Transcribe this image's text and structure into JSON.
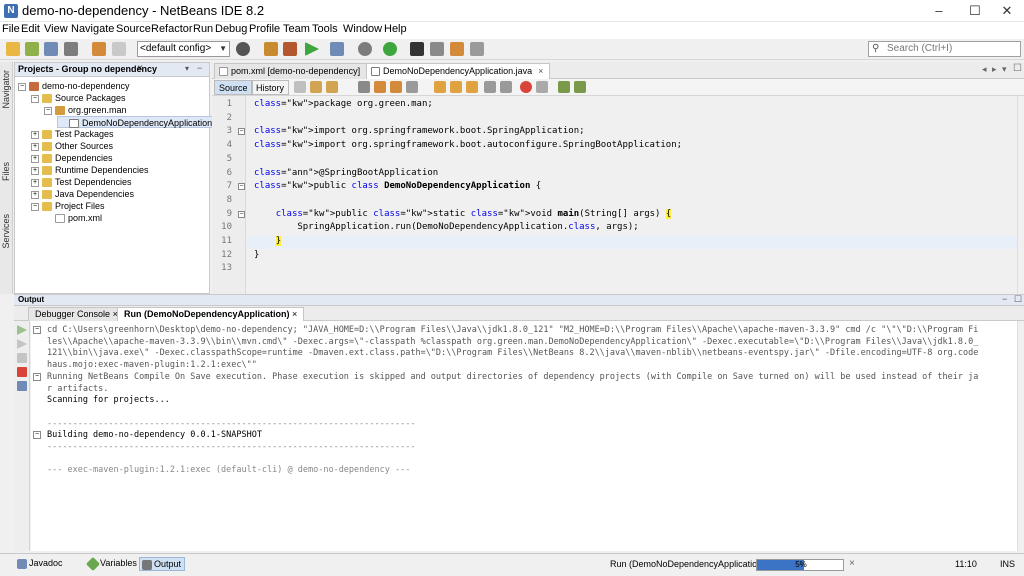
{
  "window": {
    "title": "demo-no-dependency - NetBeans IDE 8.2",
    "app_logo": "netbeans-logo",
    "controls": [
      "–",
      "☐",
      "✕"
    ]
  },
  "menu": [
    "File",
    "Edit",
    "View",
    "Navigate",
    "Source",
    "Refactor",
    "Run",
    "Debug",
    "Profile",
    "Team",
    "Tools",
    "Window",
    "Help"
  ],
  "toolbar": {
    "config": "<default config>",
    "search_placeholder": "Search (Ctrl+I)"
  },
  "side_labels": [
    "Navigator",
    "Files",
    "Services"
  ],
  "projects": {
    "title": "Projects - Group no dependency",
    "close": "×",
    "tree": [
      {
        "label": "demo-no-dependency",
        "level": 0,
        "toggle": "−",
        "icon": "project"
      },
      {
        "label": "Source Packages",
        "level": 1,
        "toggle": "−",
        "icon": "folder"
      },
      {
        "label": "org.green.man",
        "level": 2,
        "toggle": "−",
        "icon": "package"
      },
      {
        "label": "DemoNoDependencyApplication.java",
        "level": 3,
        "toggle": "",
        "icon": "java",
        "selected": true
      },
      {
        "label": "Test Packages",
        "level": 1,
        "toggle": "+",
        "icon": "folder"
      },
      {
        "label": "Other Sources",
        "level": 1,
        "toggle": "+",
        "icon": "folder"
      },
      {
        "label": "Dependencies",
        "level": 1,
        "toggle": "+",
        "icon": "folder"
      },
      {
        "label": "Runtime Dependencies",
        "level": 1,
        "toggle": "+",
        "icon": "folder"
      },
      {
        "label": "Test Dependencies",
        "level": 1,
        "toggle": "+",
        "icon": "folder"
      },
      {
        "label": "Java Dependencies",
        "level": 1,
        "toggle": "+",
        "icon": "folder"
      },
      {
        "label": "Project Files",
        "level": 1,
        "toggle": "−",
        "icon": "folder"
      },
      {
        "label": "pom.xml",
        "level": 2,
        "toggle": "",
        "icon": "xml"
      }
    ]
  },
  "editor": {
    "tabs": [
      {
        "label": "pom.xml [demo-no-dependency]",
        "close": "×",
        "active": false
      },
      {
        "label": "DemoNoDependencyApplication.java",
        "close": "×",
        "active": true
      }
    ],
    "source_label": "Source",
    "history_label": "History",
    "line_numbers": [
      "1",
      "2",
      "3",
      "4",
      "5",
      "6",
      "7",
      "8",
      "9",
      "10",
      "11",
      "12",
      "13"
    ],
    "code": [
      "package org.green.man;",
      "",
      "import org.springframework.boot.SpringApplication;",
      "import org.springframework.boot.autoconfigure.SpringBootApplication;",
      "",
      "@SpringBootApplication",
      "public class DemoNoDependencyApplication {",
      "",
      "    public static void main(String[] args) {",
      "        SpringApplication.run(DemoNoDependencyApplication.class, args);",
      "    }",
      "}",
      ""
    ]
  },
  "output": {
    "title": "Output",
    "tabs": [
      {
        "label": "Debugger Console",
        "close": "×",
        "active": false
      },
      {
        "label": "Run (DemoNoDependencyApplication)",
        "close": "×",
        "active": true
      }
    ],
    "lines": [
      "cd C:\\Users\\greenhorn\\Desktop\\demo-no-dependency; \"JAVA_HOME=D:\\\\Program Files\\\\Java\\\\jdk1.8.0_121\" \"M2_HOME=D:\\\\Program Files\\\\Apache\\\\apache-maven-3.3.9\" cmd /c \"\\\"\\\"D:\\\\Program Fi",
      "les\\\\Apache\\\\apache-maven-3.3.9\\\\bin\\\\mvn.cmd\\\" -Dexec.args=\\\"-classpath %classpath org.green.man.DemoNoDependencyApplication\\\" -Dexec.executable=\\\"D:\\\\Program Files\\\\Java\\\\jdk1.8.0_",
      "121\\\\bin\\\\java.exe\\\" -Dexec.classpathScope=runtime -Dmaven.ext.class.path=\\\"D:\\\\Program Files\\\\NetBeans 8.2\\\\java\\\\maven-nblib\\\\netbeans-eventspy.jar\\\" -Dfile.encoding=UTF-8 org.code",
      "haus.mojo:exec-maven-plugin:1.2.1:exec\\\"\"",
      "Running NetBeans Compile On Save execution. Phase execution is skipped and output directories of dependency projects (with Compile on Save turned on) will be used instead of their ja",
      "r artifacts.",
      "Scanning for projects...",
      "",
      "------------------------------------------------------------------------",
      "Building demo-no-dependency 0.0.1-SNAPSHOT",
      "------------------------------------------------------------------------",
      "",
      "--- exec-maven-plugin:1.2.1:exec (default-cli) @ demo-no-dependency ---"
    ]
  },
  "statusbar": {
    "tabs": [
      {
        "label": "Javadoc",
        "icon": "javadoc-icon",
        "active": false
      },
      {
        "label": "Variables",
        "icon": "variables-icon",
        "active": false
      },
      {
        "label": "Output",
        "icon": "output-icon",
        "active": true
      }
    ],
    "run_label": "Run (DemoNoDependencyApplication)",
    "progress_label": "5%",
    "progress_value": 0.55,
    "progress_close": "×",
    "caret": "11:10",
    "mode": "INS"
  },
  "colors": {
    "keyword": "#0000e6",
    "annotation": "#7a7a00",
    "current_line": "#e9eff8",
    "brace_highlight": "#ffef42",
    "progress": "#3b73c5"
  }
}
